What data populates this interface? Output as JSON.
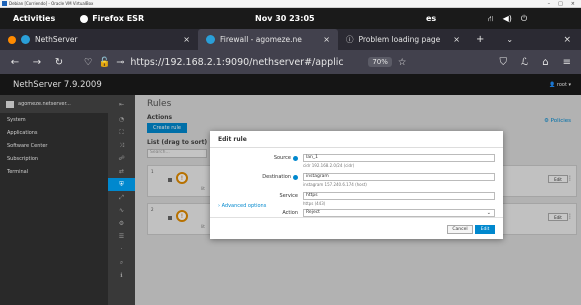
{
  "vbox": {
    "title": "Debian [Corriendo] - Oracle VM VirtualBox",
    "controls": [
      "–",
      "□",
      "×"
    ]
  },
  "gnome": {
    "activities": "Activities",
    "app_name": "Firefox ESR",
    "clock": "Nov 30  23:05",
    "lang": "es",
    "tray_icons": [
      "network-icon",
      "volume-icon",
      "power-icon"
    ]
  },
  "tabs": [
    {
      "label": "NethServer",
      "close": "×"
    },
    {
      "label": "Firewall - agomeze.ne",
      "close": "×"
    },
    {
      "label": "Problem loading page",
      "close": "×"
    }
  ],
  "tabbar": {
    "new_tab": "+",
    "list": "⌄",
    "close_window": "×"
  },
  "urlbar": {
    "url": "https://192.168.2.1:9090/nethserver#/applic",
    "zoom": "70%"
  },
  "cockpit": {
    "product": "NethServer 7.9.2009",
    "user": "root ▾"
  },
  "sidebar": {
    "host": "agomeze.netserver...",
    "items": [
      "System",
      "Applications",
      "Software Center",
      "Subscription",
      "Terminal"
    ]
  },
  "main": {
    "title": "Rules",
    "actions_label": "Actions",
    "create_rule": "Create rule",
    "list_title": "List (drag to sort)",
    "search_placeholder": "Search...",
    "policies": "Policies",
    "rows": [
      {
        "num": "1",
        "badge": "!",
        "mini": "lit",
        "edit": "Edit"
      },
      {
        "num": "2",
        "badge": "!",
        "mini": "lit",
        "edit": "Edit"
      }
    ]
  },
  "modal": {
    "title": "Edit rule",
    "source_label": "Source",
    "source_value": "lan_1",
    "source_hint": "cidr 192.168.2.0/24 (cidr)",
    "destination_label": "Destination",
    "destination_value": "instagram",
    "destination_hint": "instagram 157.240.6.174 (host)",
    "service_label": "Service",
    "service_value": "https",
    "service_hint": "https (443)",
    "action_label": "Action",
    "action_value": "Reject",
    "advanced": "Advanced options",
    "cancel": "Cancel",
    "edit": "Edit"
  }
}
